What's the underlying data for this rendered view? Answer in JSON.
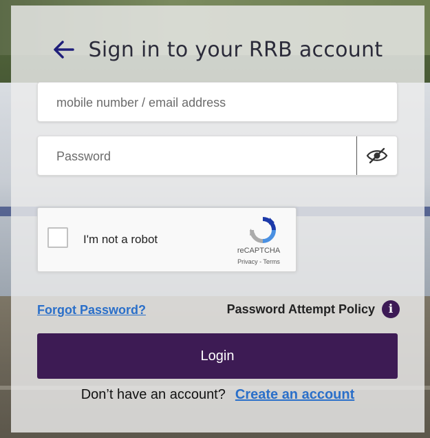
{
  "header": {
    "back_icon": "arrow-left-icon",
    "title": "Sign in to your RRB account"
  },
  "form": {
    "username_placeholder": "mobile number / email address",
    "password_placeholder": "Password",
    "password_toggle_icon": "eye-slash-icon"
  },
  "captcha": {
    "label": "I'm not a robot",
    "brand": "reCAPTCHA",
    "links": "Privacy - Terms"
  },
  "links": {
    "forgot": "Forgot Password?",
    "policy": "Password Attempt Policy",
    "policy_icon": "info-icon"
  },
  "login_label": "Login",
  "signup": {
    "prompt": "Don’t have an account?",
    "link": "Create an account"
  },
  "colors": {
    "primary": "#3d1b54",
    "link": "#2a6fc9",
    "back_arrow": "#1f1f7a"
  }
}
